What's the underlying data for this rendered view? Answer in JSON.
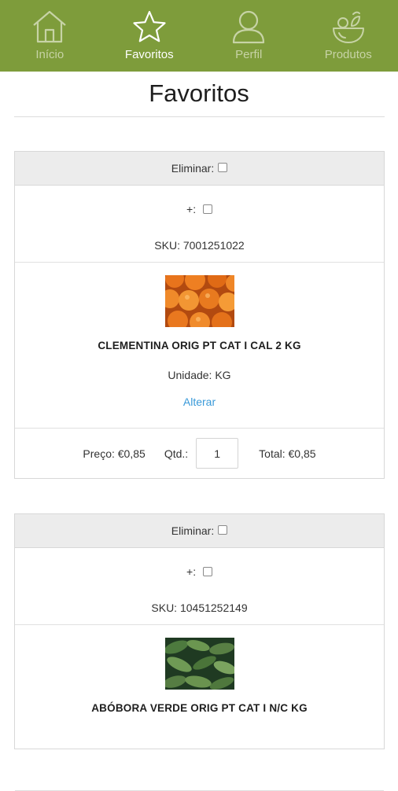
{
  "nav": {
    "items": [
      {
        "label": "Início",
        "icon": "home-icon"
      },
      {
        "label": "Favoritos",
        "icon": "star-icon",
        "active": true
      },
      {
        "label": "Perfil",
        "icon": "user-icon"
      },
      {
        "label": "Produtos",
        "icon": "produce-icon"
      }
    ]
  },
  "page": {
    "title": "Favoritos"
  },
  "cards": [
    {
      "remove_label": "Eliminar:",
      "select_label": "+:",
      "sku": "SKU: 7001251022",
      "name": "CLEMENTINA ORIG PT CAT I CAL 2 KG",
      "unit": "Unidade: KG",
      "change_label": "Alterar",
      "price": "Preço: €0,85",
      "qty_label": "Qtd.:",
      "qty_value": "1",
      "total": "Total: €0,85"
    },
    {
      "remove_label": "Eliminar:",
      "select_label": "+:",
      "sku": "SKU: 10451252149",
      "name": "ABÓBORA VERDE ORIG PT CAT I N/C KG"
    }
  ],
  "colors": {
    "brand": "#7e9c3b",
    "link": "#3a9ad9",
    "header_bg": "#ececec"
  }
}
